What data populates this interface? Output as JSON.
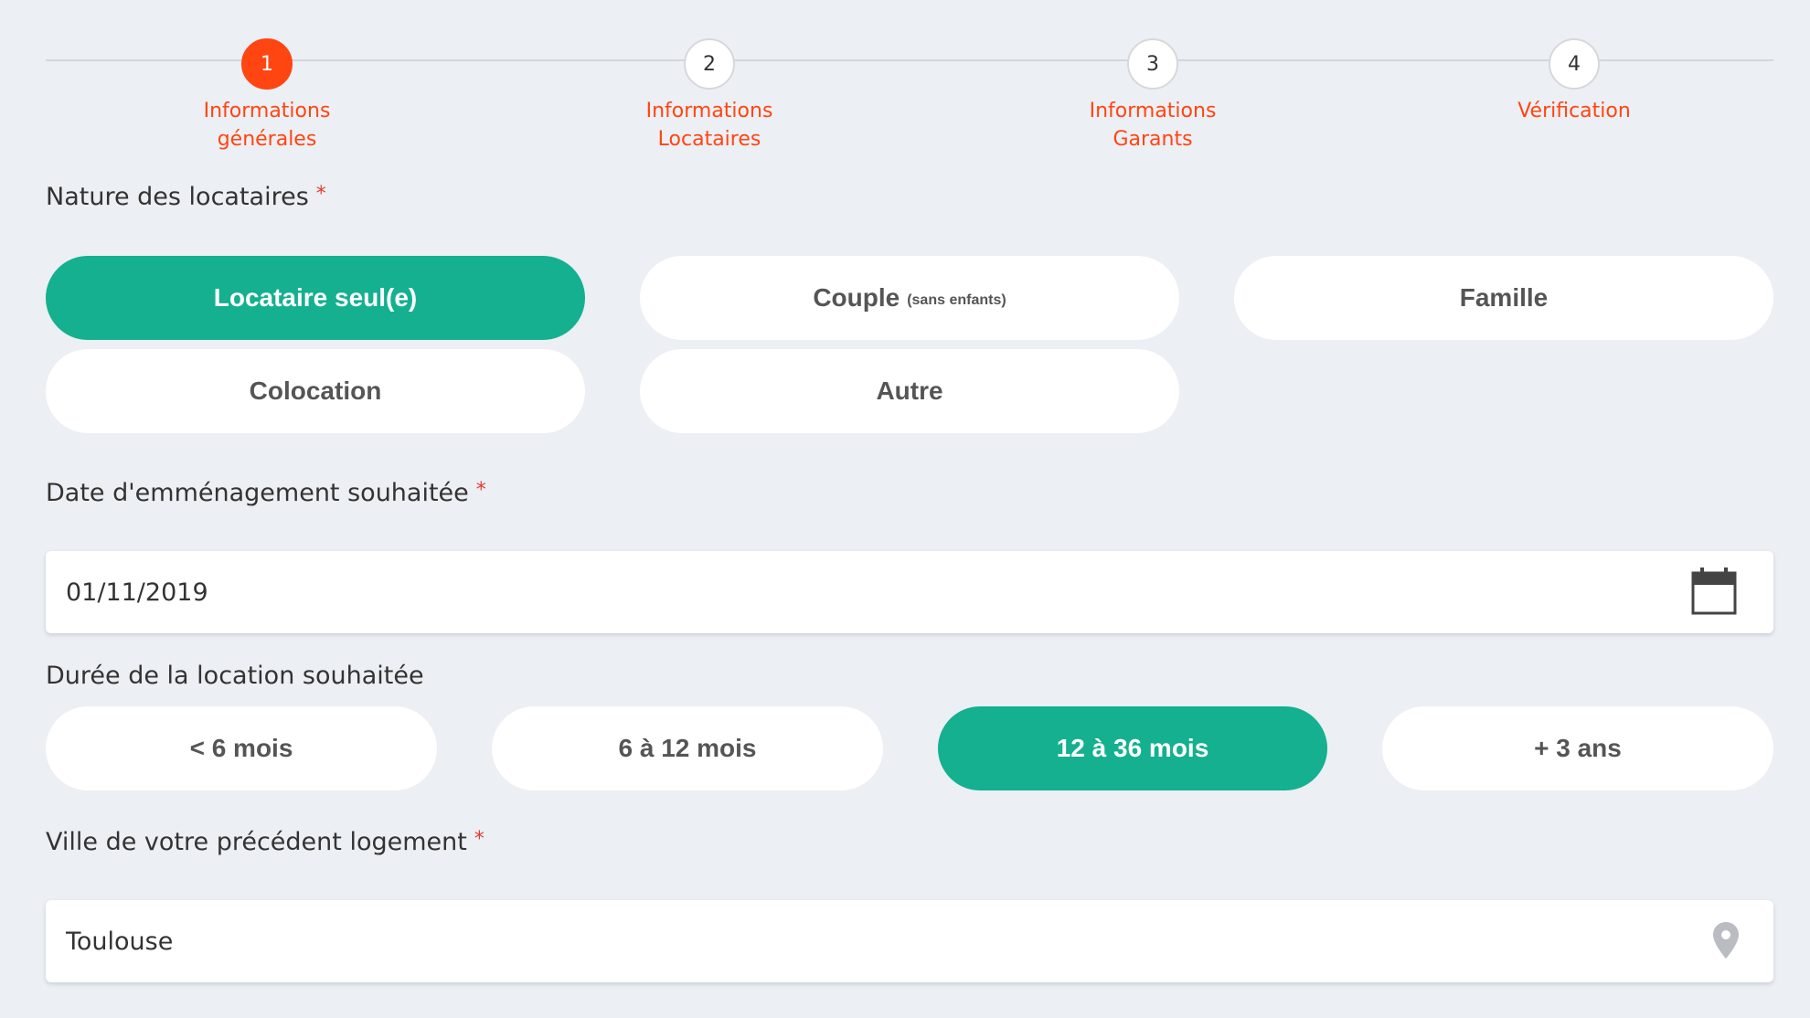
{
  "stepper": {
    "steps": [
      {
        "number": "1",
        "label": "Informations\ngénérales",
        "active": true
      },
      {
        "number": "2",
        "label": "Informations\nLocataires",
        "active": false
      },
      {
        "number": "3",
        "label": "Informations\nGarants",
        "active": false
      },
      {
        "number": "4",
        "label": "Vérification",
        "active": false
      }
    ]
  },
  "tenant_type": {
    "label": "Nature des locataires",
    "required_mark": "*",
    "options": [
      {
        "label": "Locataire seul(e)",
        "selected": true
      },
      {
        "label": "Couple",
        "sub": "(sans enfants)",
        "selected": false
      },
      {
        "label": "Famille",
        "selected": false
      },
      {
        "label": "Colocation",
        "selected": false
      },
      {
        "label": "Autre",
        "selected": false
      }
    ]
  },
  "move_in_date": {
    "label": "Date d'emménagement souhaitée",
    "required_mark": "*",
    "value": "01/11/2019",
    "icon": "calendar-icon"
  },
  "rental_duration": {
    "label": "Durée de la location souhaitée",
    "options": [
      {
        "label": "< 6 mois",
        "selected": false
      },
      {
        "label": "6 à 12 mois",
        "selected": false
      },
      {
        "label": "12 à 36 mois",
        "selected": true
      },
      {
        "label": "+ 3 ans",
        "selected": false
      }
    ]
  },
  "previous_city": {
    "label": "Ville de votre précédent logement",
    "required_mark": "*",
    "value": "Toulouse",
    "icon": "map-pin-icon"
  },
  "colors": {
    "accent_orange": "#ff4512",
    "selected_green": "#14b08f",
    "required_red": "#e63b2e"
  }
}
